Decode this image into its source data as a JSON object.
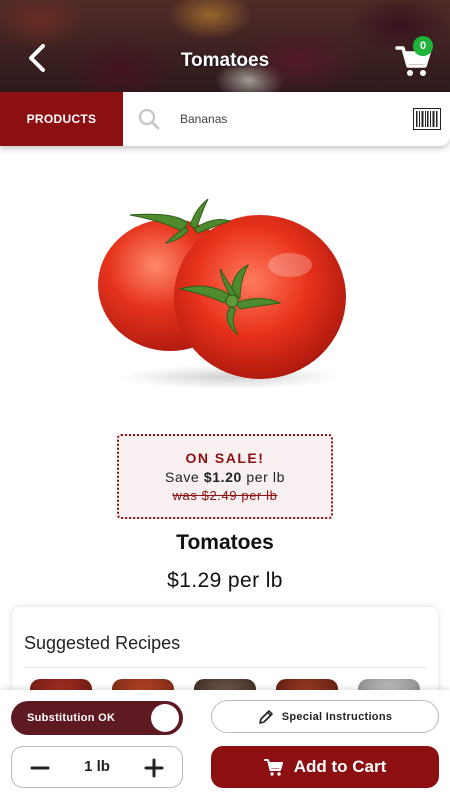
{
  "header": {
    "title": "Tomatoes",
    "cart_count": "0"
  },
  "search": {
    "products_label": "PRODUCTS",
    "value": "Bananas"
  },
  "sale": {
    "title": "ON SALE!",
    "save_prefix": "Save ",
    "save_amount": "$1.20",
    "save_suffix": " per lb",
    "was_text": "was $2.49 per lb"
  },
  "product": {
    "name": "Tomatoes",
    "price": "$1.29 per lb"
  },
  "recipes": {
    "title": "Suggested Recipes"
  },
  "actions": {
    "substitution_label": "Substitution OK",
    "substitution_on": true,
    "special_instructions_label": "Special Instructions",
    "quantity": "1 lb",
    "add_to_cart_label": "Add to Cart"
  },
  "colors": {
    "brand": "#8c0f12",
    "toggle": "#5e1a22",
    "badge": "#1fb33a"
  },
  "icons": [
    "back-icon",
    "cart-icon",
    "search-icon",
    "barcode-icon",
    "pencil-icon",
    "minus-icon",
    "plus-icon"
  ]
}
